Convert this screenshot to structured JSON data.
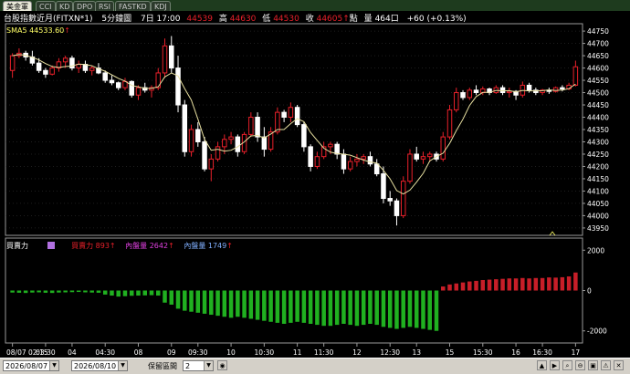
{
  "tabs": [
    "美金軍",
    "CCI",
    "KD",
    "DPO",
    "RSI",
    "FASTKD",
    "KDJ"
  ],
  "header": {
    "symbol": "台股指數近月(FITXN*1)",
    "interval": "5分鐘圖",
    "day_time": "7日 17:00",
    "open_value": "44539",
    "high_label": "高",
    "high_value": "44630",
    "low_label": "低",
    "low_value": "44530",
    "close_label": "收",
    "close_value": "44605",
    "unit_label": "點",
    "volume_label": "量",
    "volume_value": "464口",
    "change": "+60 (+0.13%)"
  },
  "indicator": {
    "label": "SMA5 44533.60",
    "arrow": "↑"
  },
  "panel2": {
    "title": "買賣力",
    "buy_label": "買賣力",
    "buy_value": "893",
    "inner_label": "內盤量",
    "inner_value": "2642",
    "outer_label": "內盤量",
    "outer_value": "1749"
  },
  "price_axis": [
    "44750",
    "44700",
    "44650",
    "44600",
    "44550",
    "44500",
    "44450",
    "44400",
    "44350",
    "44300",
    "44250",
    "44200",
    "44150",
    "44100",
    "44050",
    "44000",
    "43950"
  ],
  "vol_axis": [
    "2000",
    "0",
    "-2000"
  ],
  "time_axis": [
    "08/07 02:15",
    "03:30",
    "04",
    "04:30",
    "08",
    "09",
    "09:30",
    "10",
    "10:30",
    "11",
    "11:30",
    "12",
    "12:30",
    "13",
    "15",
    "15:30",
    "16",
    "16:30",
    "17"
  ],
  "bottom": {
    "date_start": "2026/08/07",
    "date_end": "2026/08/10",
    "range_label": "保留區間",
    "range_value": "2"
  },
  "colors": {
    "up": "#e8202a",
    "down": "#ffffff",
    "sma": "#e8e0a0",
    "bar_pos": "#c81e28",
    "bar_neg": "#20b020",
    "grid": "#3c3c3c"
  },
  "chart_data": {
    "type": "candlestick",
    "candles": [
      [
        44590,
        44660,
        44560,
        44650
      ],
      [
        44650,
        44680,
        44640,
        44660
      ],
      [
        44660,
        44670,
        44630,
        44645
      ],
      [
        44645,
        44670,
        44610,
        44620
      ],
      [
        44620,
        44640,
        44580,
        44590
      ],
      [
        44590,
        44600,
        44560,
        44575
      ],
      [
        44575,
        44610,
        44570,
        44600
      ],
      [
        44600,
        44640,
        44585,
        44625
      ],
      [
        44625,
        44650,
        44600,
        44640
      ],
      [
        44640,
        44650,
        44590,
        44600
      ],
      [
        44600,
        44630,
        44580,
        44615
      ],
      [
        44615,
        44630,
        44580,
        44590
      ],
      [
        44590,
        44610,
        44570,
        44600
      ],
      [
        44600,
        44620,
        44575,
        44580
      ],
      [
        44580,
        44590,
        44540,
        44550
      ],
      [
        44550,
        44570,
        44530,
        44540
      ],
      [
        44540,
        44545,
        44510,
        44520
      ],
      [
        44520,
        44560,
        44510,
        44545
      ],
      [
        44545,
        44550,
        44480,
        44490
      ],
      [
        44490,
        44530,
        44470,
        44520
      ],
      [
        44520,
        44540,
        44500,
        44510
      ],
      [
        44510,
        44530,
        44480,
        44520
      ],
      [
        44520,
        44600,
        44510,
        44580
      ],
      [
        44580,
        44720,
        44560,
        44690
      ],
      [
        44690,
        44730,
        44580,
        44600
      ],
      [
        44600,
        44650,
        44420,
        44450
      ],
      [
        44450,
        44470,
        44240,
        44260
      ],
      [
        44260,
        44370,
        44240,
        44350
      ],
      [
        44350,
        44380,
        44280,
        44300
      ],
      [
        44300,
        44320,
        44180,
        44190
      ],
      [
        44190,
        44250,
        44140,
        44230
      ],
      [
        44230,
        44300,
        44220,
        44280
      ],
      [
        44280,
        44330,
        44250,
        44310
      ],
      [
        44310,
        44340,
        44290,
        44320
      ],
      [
        44320,
        44330,
        44240,
        44260
      ],
      [
        44260,
        44340,
        44250,
        44330
      ],
      [
        44330,
        44420,
        44320,
        44400
      ],
      [
        44400,
        44420,
        44300,
        44320
      ],
      [
        44320,
        44360,
        44240,
        44270
      ],
      [
        44270,
        44360,
        44260,
        44340
      ],
      [
        44340,
        44440,
        44330,
        44420
      ],
      [
        44420,
        44430,
        44380,
        44400
      ],
      [
        44400,
        44460,
        44380,
        44440
      ],
      [
        44440,
        44450,
        44360,
        44370
      ],
      [
        44370,
        44380,
        44260,
        44280
      ],
      [
        44280,
        44290,
        44180,
        44200
      ],
      [
        44200,
        44260,
        44190,
        44240
      ],
      [
        44240,
        44300,
        44230,
        44280
      ],
      [
        44280,
        44300,
        44250,
        44290
      ],
      [
        44290,
        44300,
        44230,
        44250
      ],
      [
        44250,
        44270,
        44170,
        44190
      ],
      [
        44190,
        44240,
        44180,
        44220
      ],
      [
        44220,
        44250,
        44200,
        44230
      ],
      [
        44230,
        44250,
        44210,
        44240
      ],
      [
        44240,
        44260,
        44200,
        44210
      ],
      [
        44210,
        44230,
        44160,
        44170
      ],
      [
        44170,
        44200,
        44050,
        44070
      ],
      [
        44070,
        44100,
        44040,
        44060
      ],
      [
        44060,
        44070,
        43960,
        44000
      ],
      [
        44000,
        44160,
        43990,
        44140
      ],
      [
        44140,
        44270,
        44130,
        44250
      ],
      [
        44250,
        44280,
        44220,
        44230
      ],
      [
        44230,
        44260,
        44210,
        44240
      ],
      [
        44240,
        44260,
        44220,
        44250
      ],
      [
        44250,
        44260,
        44220,
        44230
      ],
      [
        44230,
        44340,
        44220,
        44320
      ],
      [
        44320,
        44450,
        44310,
        44430
      ],
      [
        44430,
        44520,
        44420,
        44500
      ],
      [
        44500,
        44510,
        44470,
        44480
      ],
      [
        44480,
        44520,
        44470,
        44510
      ],
      [
        44510,
        44530,
        44490,
        44500
      ],
      [
        44500,
        44525,
        44490,
        44515
      ],
      [
        44515,
        44520,
        44490,
        44500
      ],
      [
        44500,
        44530,
        44495,
        44520
      ],
      [
        44520,
        44530,
        44490,
        44500
      ],
      [
        44500,
        44520,
        44480,
        44505
      ],
      [
        44505,
        44510,
        44470,
        44490
      ],
      [
        44490,
        44545,
        44480,
        44530
      ],
      [
        44530,
        44540,
        44500,
        44510
      ],
      [
        44510,
        44520,
        44490,
        44500
      ],
      [
        44500,
        44515,
        44490,
        44510
      ],
      [
        44510,
        44520,
        44495,
        44505
      ],
      [
        44505,
        44525,
        44500,
        44520
      ],
      [
        44520,
        44530,
        44505,
        44515
      ],
      [
        44515,
        44540,
        44510,
        44530
      ],
      [
        44530,
        44630,
        44525,
        44605
      ]
    ],
    "net_volume": [
      -100,
      -110,
      -120,
      -100,
      -90,
      -110,
      -120,
      -100,
      -90,
      -80,
      -70,
      -90,
      -100,
      -110,
      -200,
      -250,
      -300,
      -280,
      -260,
      -250,
      -240,
      -230,
      -250,
      -600,
      -700,
      -900,
      -1000,
      -1050,
      -1100,
      -1150,
      -1200,
      -1250,
      -1300,
      -1350,
      -1300,
      -1350,
      -1400,
      -1450,
      -1500,
      -1550,
      -1600,
      -1650,
      -1600,
      -1550,
      -1600,
      -1650,
      -1700,
      -1750,
      -1750,
      -1700,
      -1650,
      -1700,
      -1750,
      -1700,
      -1650,
      -1700,
      -1800,
      -1850,
      -1900,
      -1850,
      -1800,
      -1850,
      -1900,
      -1950,
      -2000,
      200,
      300,
      350,
      400,
      450,
      480,
      520,
      540,
      560,
      580,
      600,
      600,
      620,
      600,
      620,
      620,
      650,
      640,
      660,
      700,
      893
    ],
    "y_range": [
      43920,
      44780
    ],
    "vol_range": [
      -2600,
      2600
    ]
  }
}
